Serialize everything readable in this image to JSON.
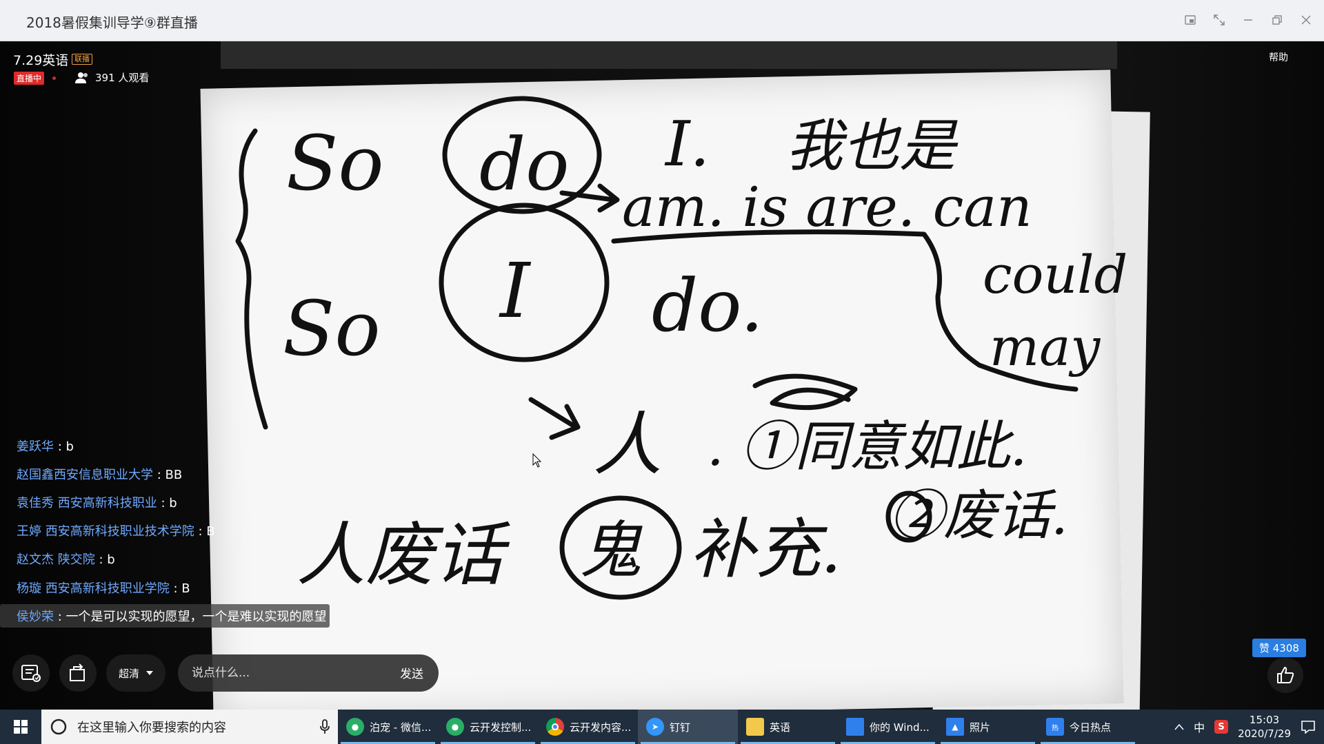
{
  "window": {
    "title": "2018暑假集训导学⑨群直播",
    "controls": [
      "pip-icon",
      "fullscreen-icon",
      "minimize-icon",
      "restore-icon",
      "close-icon"
    ]
  },
  "stream": {
    "title": "7.29英语",
    "tag": "联播",
    "live_label": "直播中",
    "viewers": "391 人观看",
    "help_label": "帮助"
  },
  "board_text": {
    "line1": "So do I. 我也是",
    "line2": "am. is are. can could may",
    "line3": "So I do.",
    "line4": "人. ①同意如此.",
    "line5": "人废话 鬼 补充. ②废话."
  },
  "comments": [
    {
      "user": "姜跃华",
      "msg": "b",
      "highlight": false
    },
    {
      "user": "赵国鑫西安信息职业大学",
      "msg": "BB",
      "highlight": false
    },
    {
      "user": "袁佳秀 西安高新科技职业",
      "msg": "b",
      "highlight": false
    },
    {
      "user": "王婷 西安高新科技职业技术学院",
      "msg": "B",
      "highlight": false
    },
    {
      "user": "赵文杰 陕交院",
      "msg": "b",
      "highlight": false
    },
    {
      "user": "杨璇 西安高新科技职业学院",
      "msg": "B",
      "highlight": false
    },
    {
      "user": "侯妙荣",
      "msg": "一个是可以实现的愿望，一个是难以实现的愿望",
      "highlight": true
    }
  ],
  "controls": {
    "quality_label": "超清",
    "chat_placeholder": "说点什么...",
    "send_label": "发送",
    "likes": "赞 4308"
  },
  "taskbar": {
    "search_placeholder": "在这里输入你要搜索的内容",
    "tasks": [
      {
        "label": "泊宠 - 微信...",
        "icon": "wechat-icon",
        "color": "#2aae67"
      },
      {
        "label": "云开发控制...",
        "icon": "wechat-icon",
        "color": "#2aae67"
      },
      {
        "label": "云开发内容...",
        "icon": "chrome-icon",
        "color": "#db4437"
      },
      {
        "label": "钉钉",
        "icon": "dingtalk-icon",
        "color": "#3296fa"
      },
      {
        "label": "英语",
        "icon": "folder-icon",
        "color": "#f2c94c"
      },
      {
        "label": "你的 Wind...",
        "icon": "window-icon",
        "color": "#2f80ed"
      },
      {
        "label": "照片",
        "icon": "photos-icon",
        "color": "#2f80ed"
      },
      {
        "label": "今日热点",
        "icon": "hot-news-icon",
        "color": "#2f80ed"
      }
    ],
    "ime_label": "中",
    "time": "15:03",
    "date": "2020/7/29"
  }
}
